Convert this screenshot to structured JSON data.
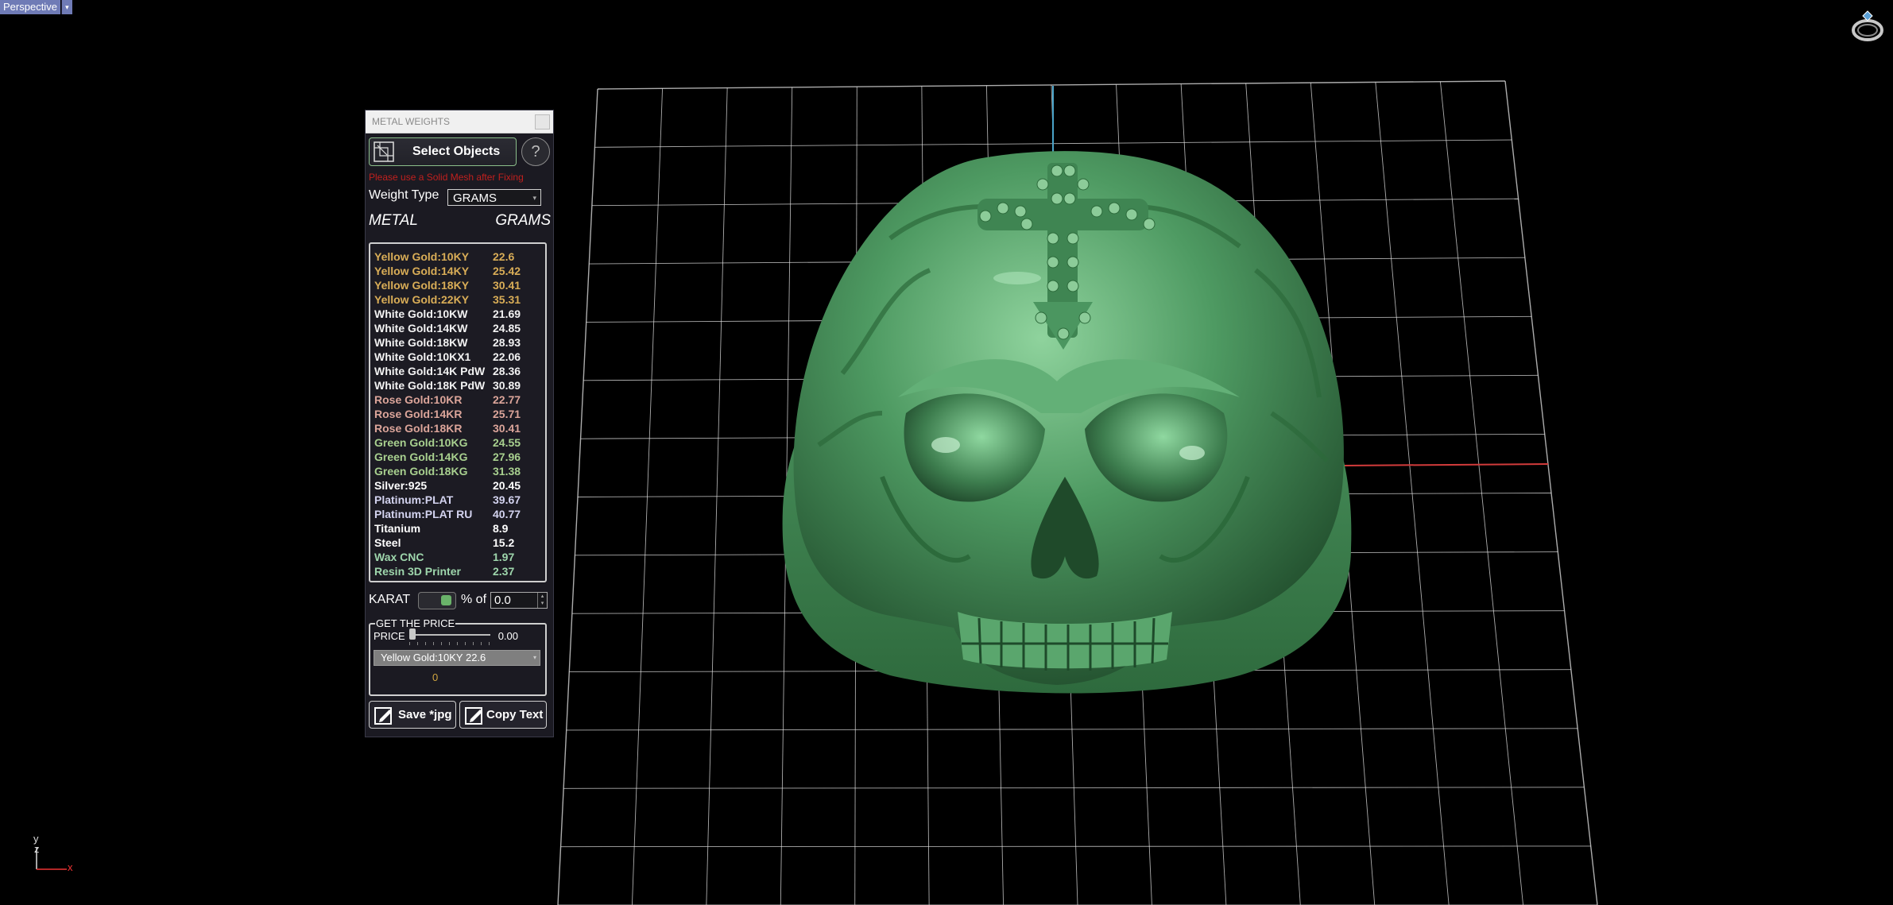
{
  "viewport": {
    "name": "Perspective"
  },
  "panel": {
    "title": "METAL WEIGHTS",
    "select_button": "Select Objects",
    "help": "?",
    "warning": "Please use a Solid Mesh after Fixing",
    "weight_type_label": "Weight Type",
    "weight_type_value": "GRAMS",
    "col_metal": "METAL",
    "col_grams": "GRAMS",
    "metals": [
      {
        "name": "Yellow Gold:10KY",
        "grams": "22.6",
        "color": "#d9ad57"
      },
      {
        "name": "Yellow Gold:14KY",
        "grams": "25.42",
        "color": "#d9ad57"
      },
      {
        "name": "Yellow Gold:18KY",
        "grams": "30.41",
        "color": "#d9ad57"
      },
      {
        "name": "Yellow Gold:22KY",
        "grams": "35.31",
        "color": "#d9ad57"
      },
      {
        "name": "White Gold:10KW",
        "grams": "21.69",
        "color": "#f2f2f2"
      },
      {
        "name": "White Gold:14KW",
        "grams": "24.85",
        "color": "#f2f2f2"
      },
      {
        "name": "White Gold:18KW",
        "grams": "28.93",
        "color": "#f2f2f2"
      },
      {
        "name": "White Gold:10KX1",
        "grams": "22.06",
        "color": "#f2f2f2"
      },
      {
        "name": "White Gold:14K PdW",
        "grams": "28.36",
        "color": "#f2f2f2"
      },
      {
        "name": "White Gold:18K PdW",
        "grams": "30.89",
        "color": "#f2f2f2"
      },
      {
        "name": "Rose Gold:10KR",
        "grams": "22.77",
        "color": "#dca59a"
      },
      {
        "name": "Rose Gold:14KR",
        "grams": "25.71",
        "color": "#dca59a"
      },
      {
        "name": "Rose Gold:18KR",
        "grams": "30.41",
        "color": "#dca59a"
      },
      {
        "name": "Green Gold:10KG",
        "grams": "24.55",
        "color": "#a8d08f"
      },
      {
        "name": "Green Gold:14KG",
        "grams": "27.96",
        "color": "#a8d08f"
      },
      {
        "name": "Green Gold:18KG",
        "grams": "31.38",
        "color": "#a8d08f"
      },
      {
        "name": "Silver:925",
        "grams": "20.45",
        "color": "#ffffff"
      },
      {
        "name": "Platinum:PLAT",
        "grams": "39.67",
        "color": "#d3d3ef"
      },
      {
        "name": "Platinum:PLAT RU",
        "grams": "40.77",
        "color": "#d3d3ef"
      },
      {
        "name": "Titanium",
        "grams": "8.9",
        "color": "#ffffff"
      },
      {
        "name": "Steel",
        "grams": "15.2",
        "color": "#ffffff"
      },
      {
        "name": "Wax  CNC",
        "grams": "1.97",
        "color": "#9ed6ac"
      },
      {
        "name": "Resin 3D Printer",
        "grams": "2.37",
        "color": "#9ed6ac"
      }
    ],
    "karat_label": "KARAT",
    "percent_label": "% of",
    "percent_value": "0.0",
    "price_group_label": "GET THE PRICE",
    "price_label": "PRICE",
    "price_value": "0.00",
    "price_slider_level": 0,
    "price_selected": "Yellow Gold:10KY 22.6",
    "price_total": "0",
    "save_button": "Save *jpg",
    "copy_button": "Copy Text"
  },
  "axis": {
    "y": "y",
    "z": "z",
    "x": "x"
  },
  "colors": {
    "model": "#4f9a63",
    "grid": "#e6e6e6",
    "viewport_label": "#6f7bb6",
    "warning": "#c0201e",
    "axis_x": "#e33"
  }
}
